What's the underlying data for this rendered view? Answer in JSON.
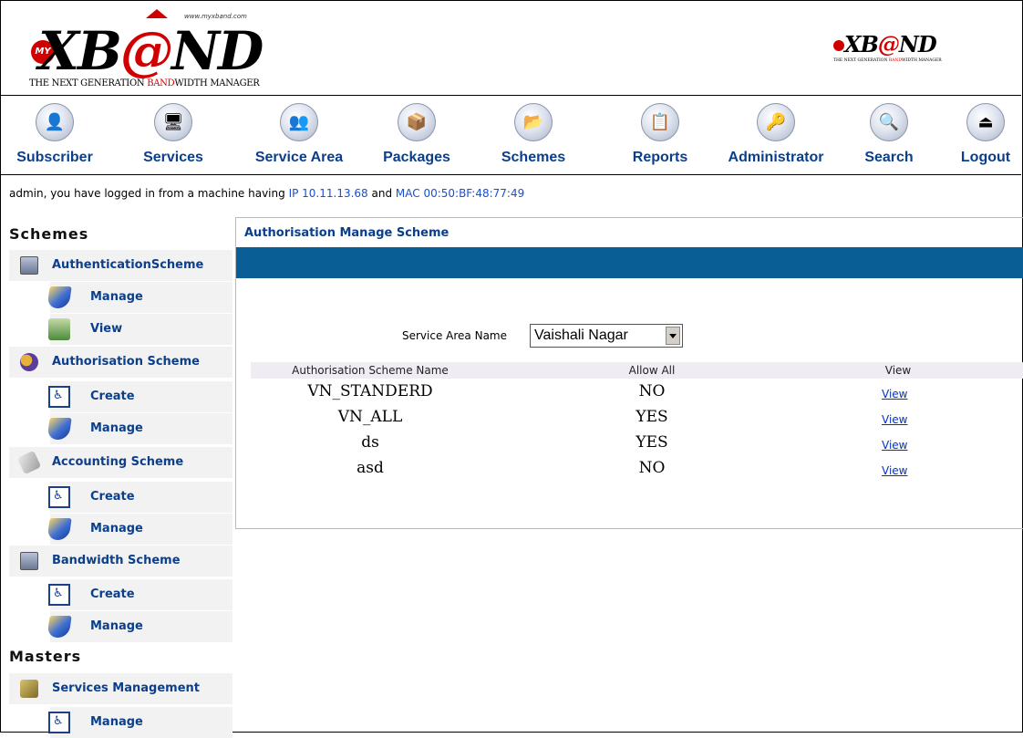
{
  "header": {
    "logo_url": "www.myxband.com",
    "logo_my": "MY",
    "logo_text_1": "XB",
    "logo_text_at": "@",
    "logo_text_2": "ND",
    "tagline_1": "THE NEXT GENERATION ",
    "tagline_red": "BAND",
    "tagline_2": "WIDTH MANAGER"
  },
  "nav": [
    {
      "label": "Subscriber",
      "icon": "subscriber-icon"
    },
    {
      "label": "Services",
      "icon": "services-icon"
    },
    {
      "label": "Service Area",
      "icon": "service-area-icon"
    },
    {
      "label": "Packages",
      "icon": "packages-icon"
    },
    {
      "label": "Schemes",
      "icon": "schemes-icon"
    },
    {
      "label": "Reports",
      "icon": "reports-icon"
    },
    {
      "label": "Administrator",
      "icon": "administrator-icon"
    },
    {
      "label": "Search",
      "icon": "search-icon"
    },
    {
      "label": "Logout",
      "icon": "logout-icon"
    }
  ],
  "login": {
    "prefix": "admin, you have logged in from a machine having ",
    "ip": "IP 10.11.13.68",
    "mid": " and ",
    "mac": "MAC 00:50:BF:48:77:49"
  },
  "sidebar": {
    "schemes_heading": "Schemes",
    "masters_heading": "Masters",
    "authentication": {
      "label": "AuthenticationScheme",
      "manage": "Manage",
      "view": "View"
    },
    "authorisation": {
      "label": "Authorisation Scheme",
      "create": "Create",
      "manage": "Manage"
    },
    "accounting": {
      "label": "Accounting Scheme",
      "create": "Create",
      "manage": "Manage"
    },
    "bandwidth": {
      "label": "Bandwidth Scheme",
      "create": "Create",
      "manage": "Manage"
    },
    "services_mgmt": {
      "label": "Services Management",
      "manage": "Manage"
    }
  },
  "panel": {
    "title": "Authorisation Manage Scheme",
    "field_label": "Service Area Name",
    "selected_area": "Vaishali Nagar",
    "columns": [
      "Authorisation Scheme Name",
      "Allow All",
      "View"
    ],
    "rows": [
      {
        "name": "VN_STANDERD",
        "allow": "NO",
        "view": "View"
      },
      {
        "name": "VN_ALL",
        "allow": "YES",
        "view": "View"
      },
      {
        "name": "ds",
        "allow": "YES",
        "view": "View"
      },
      {
        "name": "asd",
        "allow": "NO",
        "view": "View"
      }
    ]
  },
  "colors": {
    "nav_text": "#0b3f8c",
    "panel_bar": "#0a5e96",
    "link": "#0033cc",
    "logo_red": "#d00000"
  }
}
